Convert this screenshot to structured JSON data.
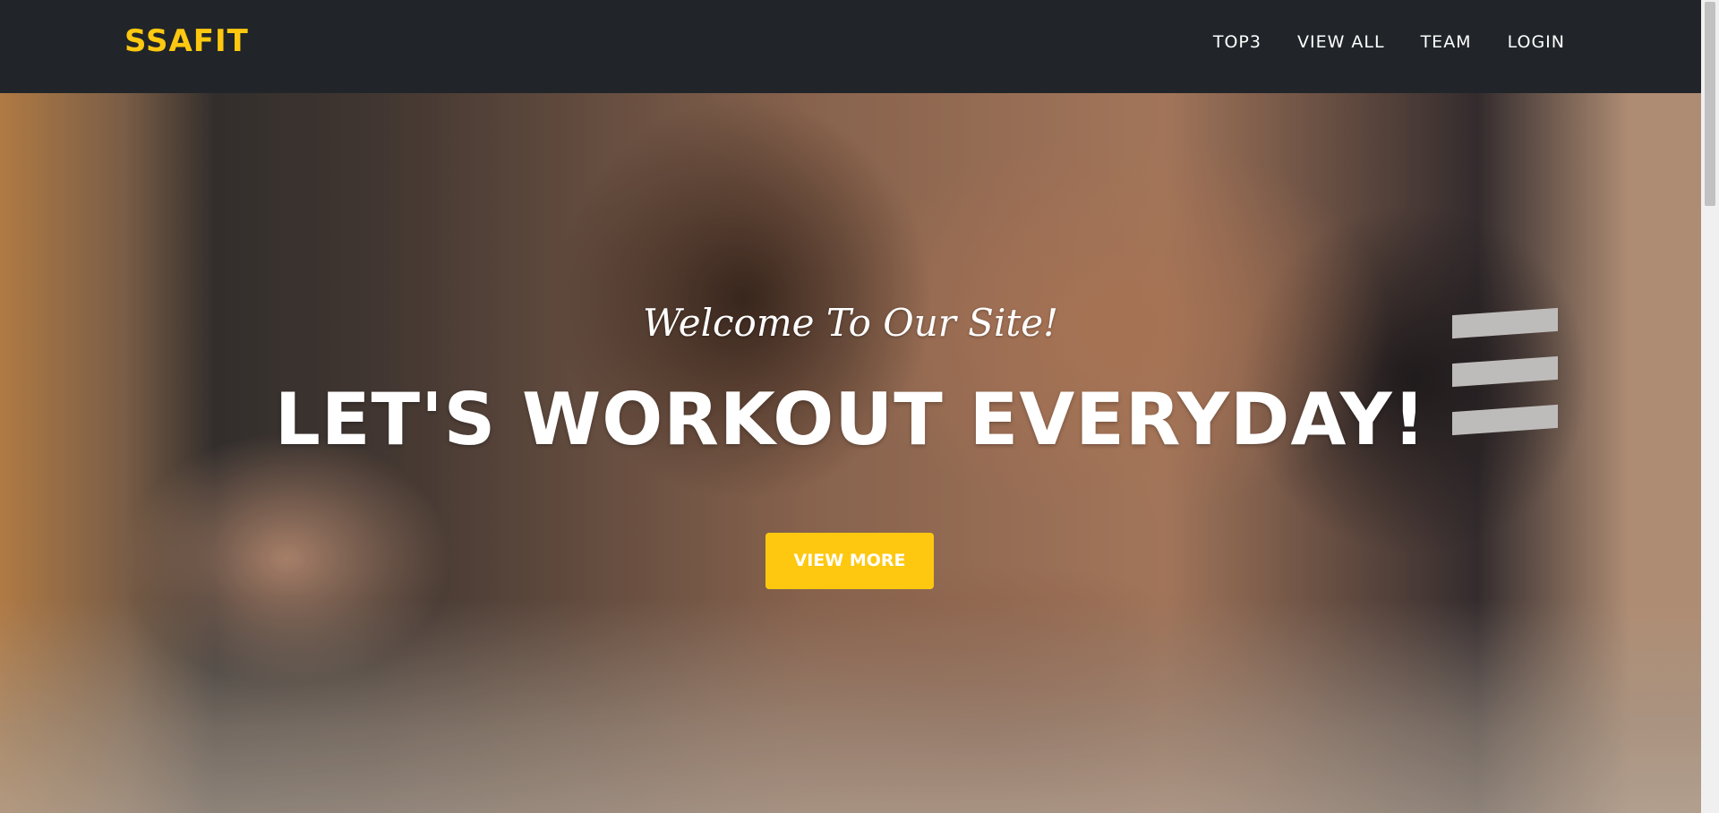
{
  "navbar": {
    "brand": "SSAFIT",
    "links": [
      "TOP3",
      "VIEW ALL",
      "TEAM",
      "LOGIN"
    ]
  },
  "hero": {
    "subheading": "Welcome To Our Site!",
    "heading": "LET'S WORKOUT EVERYDAY!",
    "cta_label": "VIEW MORE"
  },
  "colors": {
    "accent": "#fec810",
    "navbar_bg": "#212529",
    "text": "#ffffff"
  }
}
